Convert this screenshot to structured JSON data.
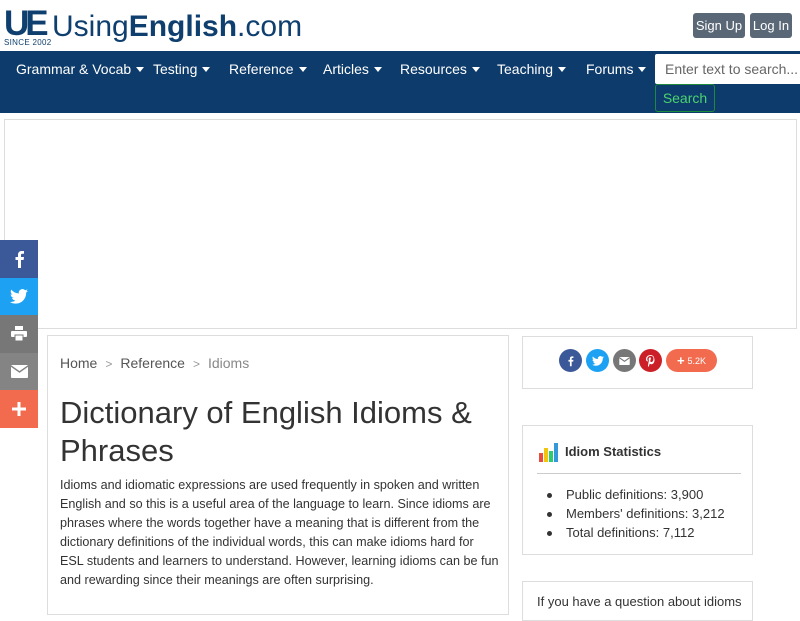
{
  "logo": {
    "mark": "UE",
    "since": "SINCE 2002",
    "name_prefix": "Using",
    "name_bold": "English",
    "name_suffix": ".com"
  },
  "auth": {
    "signup": "Sign Up",
    "login": "Log In"
  },
  "nav": {
    "items": [
      "Grammar & Vocab",
      "Testing",
      "Reference",
      "Articles",
      "Resources",
      "Teaching",
      "Forums"
    ],
    "search_placeholder": "Enter text to search...",
    "search_button": "Search"
  },
  "share_sidebar": [
    "facebook-icon",
    "twitter-icon",
    "print-icon",
    "email-icon",
    "plus-icon"
  ],
  "breadcrumb": {
    "home": "Home",
    "sep": ">",
    "reference": "Reference",
    "current": "Idioms"
  },
  "page": {
    "title": "Dictionary of English Idioms & Phrases",
    "intro": "Idioms and idiomatic expressions are used frequently in spoken and written English and so this is a useful area of the language to learn. Since idioms are phrases where the words together have a meaning that is different from the dictionary definitions of the individual words, this can make idioms hard for ESL students and learners to understand. However, learning idioms can be fun and rewarding since their meanings are often surprising."
  },
  "share_card": {
    "icons": [
      "facebook-icon",
      "twitter-icon",
      "email-icon",
      "pinterest-icon"
    ],
    "count": "5.2K"
  },
  "stats": {
    "title": "Idiom Statistics",
    "items": [
      {
        "label": "Public definitions:",
        "value": "3,900"
      },
      {
        "label": "Members' definitions:",
        "value": "3,212"
      },
      {
        "label": "Total definitions:",
        "value": "7,112"
      }
    ]
  },
  "question_card": {
    "text": "If you have a question about idioms"
  },
  "colors": {
    "brand_navy": "#0d3b6b",
    "facebook": "#3b5998",
    "twitter": "#1da1f2",
    "pinterest": "#cb2027",
    "share_plus": "#f26b4f",
    "search_green": "#4cd36f"
  }
}
